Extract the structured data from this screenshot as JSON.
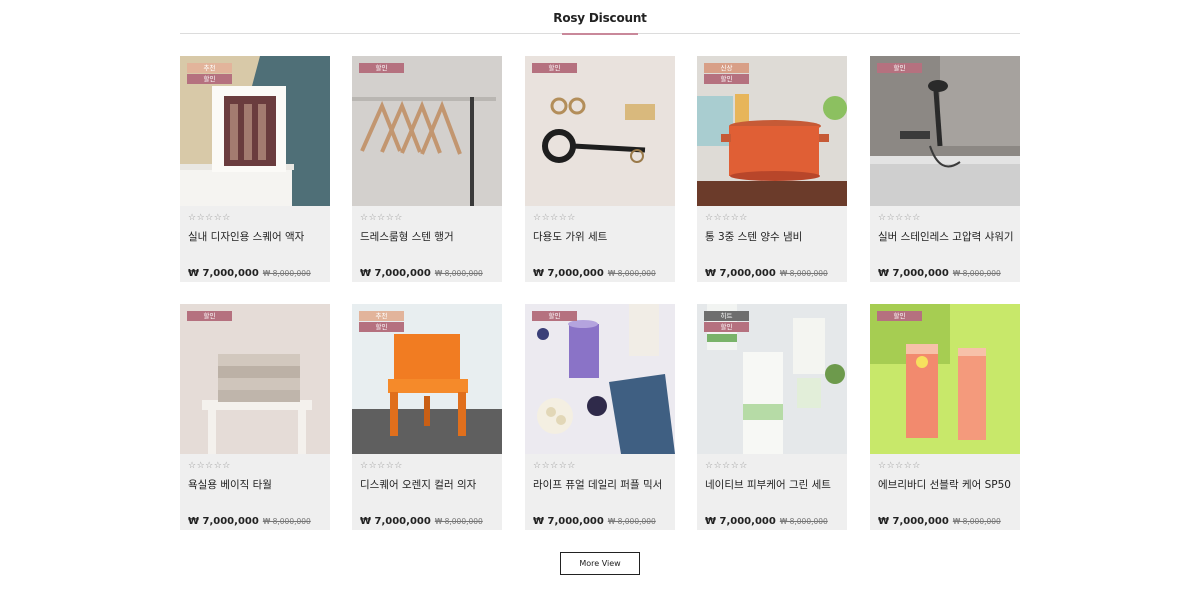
{
  "section": {
    "title": "Rosy Discount"
  },
  "badge_colors": {
    "추천": "#e2b49b",
    "할인": "#b5717f",
    "신상": "#d89f87",
    "히트": "#6e6e6e"
  },
  "rating_stars": "☆☆☆☆☆",
  "products": [
    {
      "name": "실내 디자인용 스퀘어 액자",
      "price": "₩ 7,000,000",
      "old_price": "₩ 8,000,000",
      "badges": [
        "추천",
        "할인"
      ],
      "image": "frame"
    },
    {
      "name": "드레스룸형 스텐 행거",
      "price": "₩ 7,000,000",
      "old_price": "₩ 8,000,000",
      "badges": [
        "할인"
      ],
      "image": "hanger"
    },
    {
      "name": "다용도 가위 세트",
      "price": "₩ 7,000,000",
      "old_price": "₩ 8,000,000",
      "badges": [
        "할인"
      ],
      "image": "scissors"
    },
    {
      "name": "통 3중 스텐 양수 냄비",
      "price": "₩ 7,000,000",
      "old_price": "₩ 8,000,000",
      "badges": [
        "신상",
        "할인"
      ],
      "image": "pot"
    },
    {
      "name": "실버 스테인레스 고압력 샤워기",
      "price": "₩ 7,000,000",
      "old_price": "₩ 8,000,000",
      "badges": [
        "할인"
      ],
      "image": "shower"
    },
    {
      "name": "욕실용 베이직 타월",
      "price": "₩ 7,000,000",
      "old_price": "₩ 8,000,000",
      "badges": [
        "할인"
      ],
      "image": "towel"
    },
    {
      "name": "디스퀘어 오렌지 컬러 의자",
      "price": "₩ 7,000,000",
      "old_price": "₩ 8,000,000",
      "badges": [
        "추천",
        "할인"
      ],
      "image": "chair"
    },
    {
      "name": "라이프 퓨얼 데일리 퍼플 믹서",
      "price": "₩ 7,000,000",
      "old_price": "₩ 8,000,000",
      "badges": [
        "할인"
      ],
      "image": "smoothie"
    },
    {
      "name": "네이티브 피부케어 그린 세트",
      "price": "₩ 7,000,000",
      "old_price": "₩ 8,000,000",
      "badges": [
        "히트",
        "할인"
      ],
      "image": "native"
    },
    {
      "name": "에브리바디 선블락 케어 SP50",
      "price": "₩ 7,000,000",
      "old_price": "₩ 8,000,000",
      "badges": [
        "할인"
      ],
      "image": "sunscreen"
    }
  ],
  "more_button": {
    "label": "More View"
  }
}
